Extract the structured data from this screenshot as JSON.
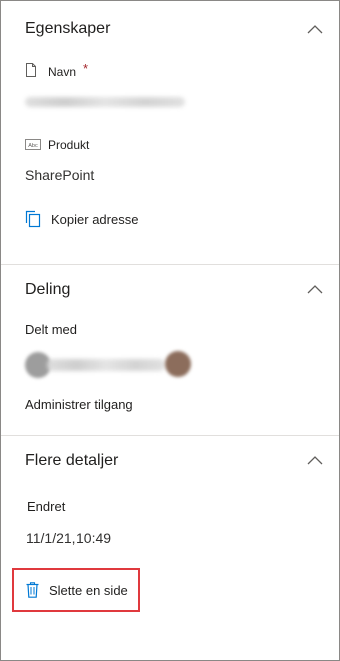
{
  "properties": {
    "title": "Egenskaper",
    "name_label": "Navn",
    "required_mark": "*",
    "product_label": "Produkt",
    "product_value": "SharePoint",
    "copy_address": "Kopier adresse"
  },
  "sharing": {
    "title": "Deling",
    "shared_with_label": "Delt med",
    "manage_access": "Administrer tilgang"
  },
  "details": {
    "title": "Flere detaljer",
    "modified_label": "Endret",
    "modified_date": "11/1/21,",
    "modified_time": "10:49"
  },
  "actions": {
    "delete_page": "Slette en side"
  },
  "colors": {
    "accent": "#0078d4",
    "required": "#a4262c",
    "highlight_border": "#e0393e",
    "divider": "#e1dfdd"
  }
}
